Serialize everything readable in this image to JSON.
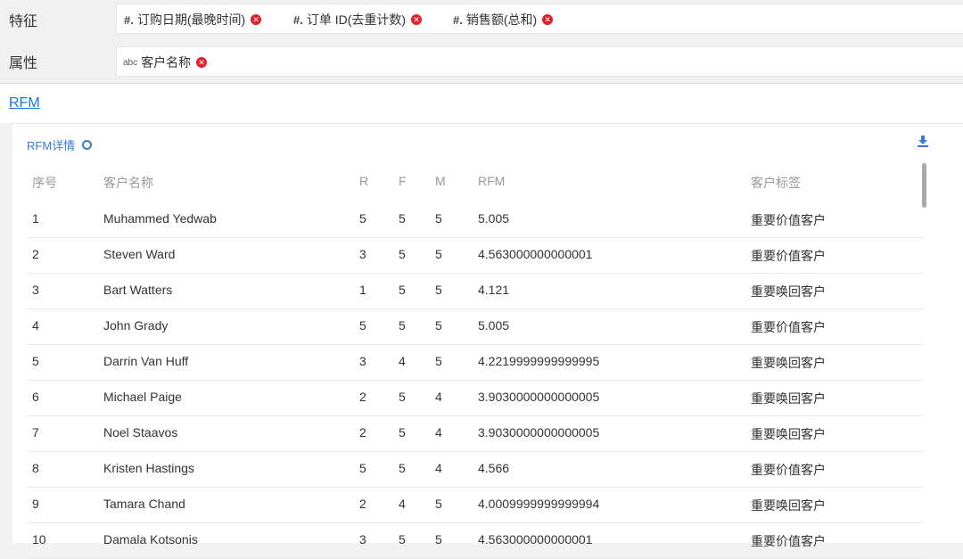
{
  "features": {
    "label": "特征",
    "fields": [
      {
        "type": "#.",
        "name": "订购日期(最晚时间)"
      },
      {
        "type": "#.",
        "name": "订单 ID(去重计数)"
      },
      {
        "type": "#.",
        "name": "销售额(总和)"
      }
    ]
  },
  "attributes": {
    "label": "属性",
    "fields": [
      {
        "type": "abc",
        "name": "客户名称"
      }
    ]
  },
  "rfm_link": "RFM",
  "panel": {
    "title": "RFM详情",
    "columns": [
      "序号",
      "客户名称",
      "R",
      "F",
      "M",
      "RFM",
      "客户标签"
    ],
    "rows": [
      [
        "1",
        "Muhammed Yedwab",
        "5",
        "5",
        "5",
        "5.005",
        "重要价值客户"
      ],
      [
        "2",
        "Steven Ward",
        "3",
        "5",
        "5",
        "4.563000000000001",
        "重要价值客户"
      ],
      [
        "3",
        "Bart Watters",
        "1",
        "5",
        "5",
        "4.121",
        "重要唤回客户"
      ],
      [
        "4",
        "John Grady",
        "5",
        "5",
        "5",
        "5.005",
        "重要价值客户"
      ],
      [
        "5",
        "Darrin Van Huff",
        "3",
        "4",
        "5",
        "4.2219999999999995",
        "重要唤回客户"
      ],
      [
        "6",
        "Michael Paige",
        "2",
        "5",
        "4",
        "3.9030000000000005",
        "重要唤回客户"
      ],
      [
        "7",
        "Noel Staavos",
        "2",
        "5",
        "4",
        "3.9030000000000005",
        "重要唤回客户"
      ],
      [
        "8",
        "Kristen Hastings",
        "5",
        "5",
        "4",
        "4.566",
        "重要价值客户"
      ],
      [
        "9",
        "Tamara Chand",
        "2",
        "4",
        "5",
        "4.0009999999999994",
        "重要唤回客户"
      ],
      [
        "10",
        "Damala Kotsonis",
        "3",
        "5",
        "5",
        "4.563000000000001",
        "重要价值客户"
      ]
    ]
  },
  "icons": {
    "remove": "remove-circle-icon",
    "download": "download-icon",
    "refresh": "refresh-ring-icon"
  },
  "colors": {
    "accent": "#3a7bd5",
    "remove": "#e0202b",
    "link": "#1a73e8"
  }
}
